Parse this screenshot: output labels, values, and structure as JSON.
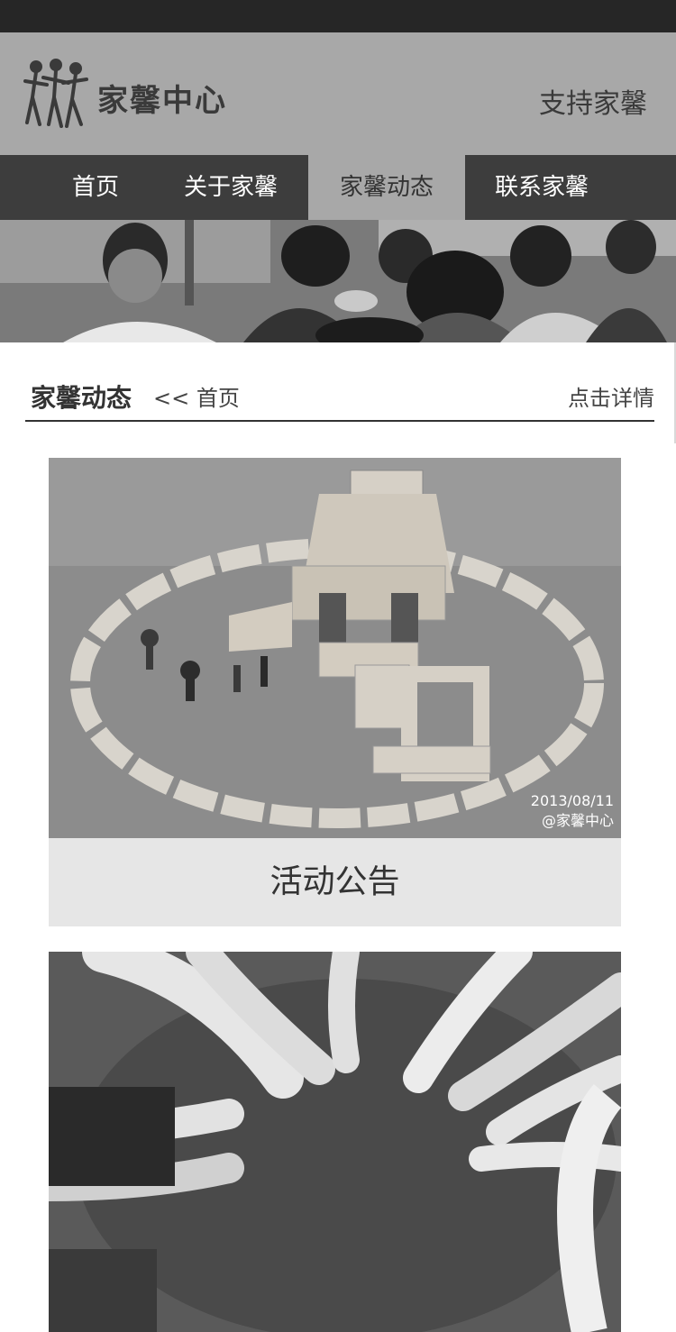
{
  "header": {
    "logo_text": "家馨中心",
    "support_link": "支持家馨"
  },
  "nav": {
    "items": [
      {
        "label": "首页"
      },
      {
        "label": "关于家馨"
      },
      {
        "label": "家馨动态"
      },
      {
        "label": "联系家馨"
      }
    ],
    "active": "家馨动态"
  },
  "section": {
    "title": "家馨动态",
    "breadcrumb": "<<  首页",
    "more": "点击详情"
  },
  "cards": [
    {
      "caption": "活动公告",
      "stamp_date": "2013/08/11",
      "stamp_credit": "@家馨中心"
    },
    {
      "caption": ""
    }
  ],
  "colors": {
    "header_bg": "#a8a8a8",
    "nav_bg": "#3d3d3d",
    "caption_bg": "#e6e6e6"
  }
}
